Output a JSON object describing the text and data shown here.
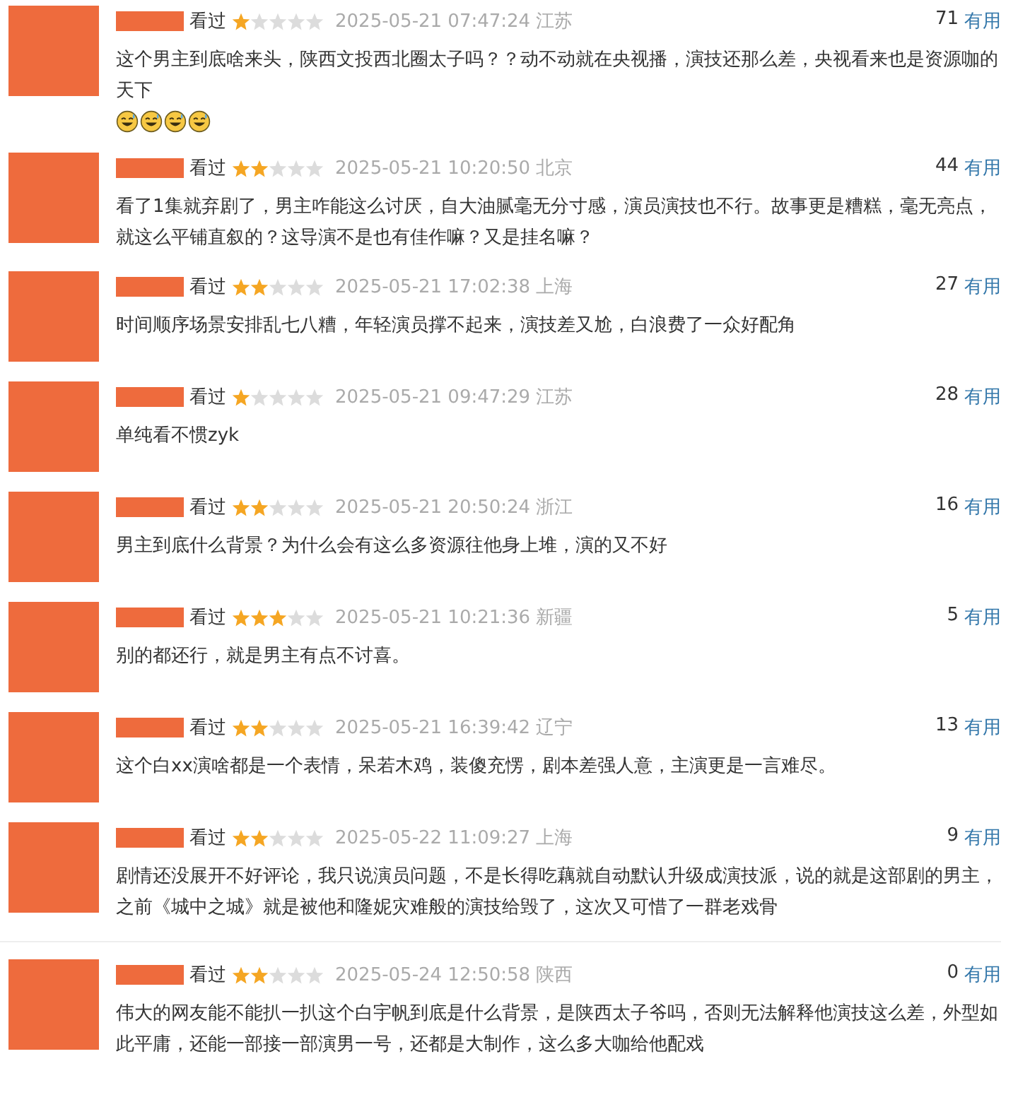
{
  "comments": [
    {
      "status": "看过",
      "stars": 1,
      "time": "2025-05-21 07:47:24 江苏",
      "votes": "71",
      "vote_label": "有用",
      "text": "这个男主到底啥来头，陕西文投西北圈太子吗？？动不动就在央视播，演技还那么差，央视看来也是资源咖的天下",
      "trailing_icons": [
        {
          "kind": "sweat-smile"
        },
        {
          "kind": "sweat-smile"
        },
        {
          "kind": "sweat-smile"
        },
        {
          "kind": "sweat-smile"
        }
      ]
    },
    {
      "status": "看过",
      "stars": 2,
      "time": "2025-05-21 10:20:50 北京",
      "votes": "44",
      "vote_label": "有用",
      "text": "看了1集就弃剧了，男主咋能这么讨厌，自大油腻毫无分寸感，演员演技也不行。故事更是糟糕，毫无亮点，就这么平铺直叙的？这导演不是也有佳作嘛？又是挂名嘛？"
    },
    {
      "status": "看过",
      "stars": 2,
      "time": "2025-05-21 17:02:38 上海",
      "votes": "27",
      "vote_label": "有用",
      "text": "时间顺序场景安排乱七八糟，年轻演员撑不起来，演技差又尬，白浪费了一众好配角"
    },
    {
      "status": "看过",
      "stars": 1,
      "time": "2025-05-21 09:47:29 江苏",
      "votes": "28",
      "vote_label": "有用",
      "text": "单纯看不惯zyk"
    },
    {
      "status": "看过",
      "stars": 2,
      "time": "2025-05-21 20:50:24 浙江",
      "votes": "16",
      "vote_label": "有用",
      "text": "男主到底什么背景？为什么会有这么多资源往他身上堆，演的又不好"
    },
    {
      "status": "看过",
      "stars": 3,
      "time": "2025-05-21 10:21:36 新疆",
      "votes": "5",
      "vote_label": "有用",
      "text": "别的都还行，就是男主有点不讨喜。"
    },
    {
      "status": "看过",
      "stars": 2,
      "time": "2025-05-21 16:39:42 辽宁",
      "votes": "13",
      "vote_label": "有用",
      "text": "这个白xx演啥都是一个表情，呆若木鸡，装傻充愣，剧本差强人意，主演更是一言难尽。"
    },
    {
      "status": "看过",
      "stars": 2,
      "time": "2025-05-22 11:09:27 上海",
      "votes": "9",
      "vote_label": "有用",
      "text": "剧情还没展开不好评论，我只说演员问题，不是长得吃藕就自动默认升级成演技派，说的就是这部剧的男主，之前《城中之城》就是被他和隆妮灾难般的演技给毁了，这次又可惜了一群老戏骨"
    },
    {
      "status": "看过",
      "stars": 2,
      "time": "2025-05-24 12:50:58 陕西",
      "votes": "0",
      "vote_label": "有用",
      "text": "伟大的网友能不能扒一扒这个白宇帆到底是什么背景，是陕西太子爷吗，否则无法解释他演技这么差，外型如此平庸，还能一部接一部演男一号，还都是大制作，这么多大咖给他配戏"
    }
  ]
}
